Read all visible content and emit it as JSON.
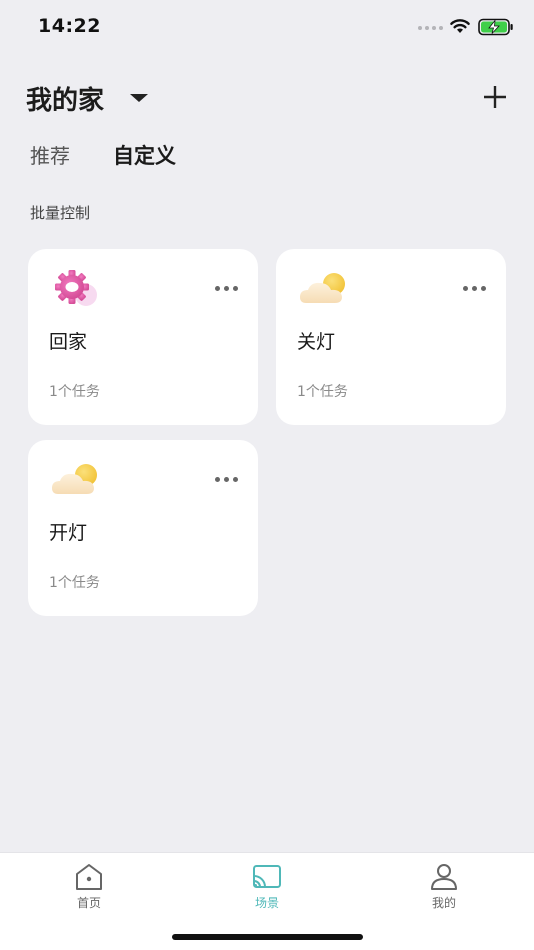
{
  "status_bar": {
    "time": "14:22"
  },
  "header": {
    "home_name": "我的家"
  },
  "tabs": [
    {
      "label": "推荐",
      "active": false
    },
    {
      "label": "自定义",
      "active": true
    }
  ],
  "section": {
    "label": "批量控制"
  },
  "scenes": [
    {
      "name": "回家",
      "tasks": "1个任务",
      "icon": "gear-icon"
    },
    {
      "name": "关灯",
      "tasks": "1个任务",
      "icon": "cloud-sun-icon"
    },
    {
      "name": "开灯",
      "tasks": "1个任务",
      "icon": "cloud-sun-icon"
    }
  ],
  "bottom_nav": [
    {
      "label": "首页",
      "icon": "home-icon",
      "active": false
    },
    {
      "label": "场景",
      "icon": "scene-icon",
      "active": true
    },
    {
      "label": "我的",
      "icon": "person-icon",
      "active": false
    }
  ],
  "colors": {
    "accent": "#4fb8b8",
    "background": "#eeeef2",
    "card": "#ffffff"
  }
}
